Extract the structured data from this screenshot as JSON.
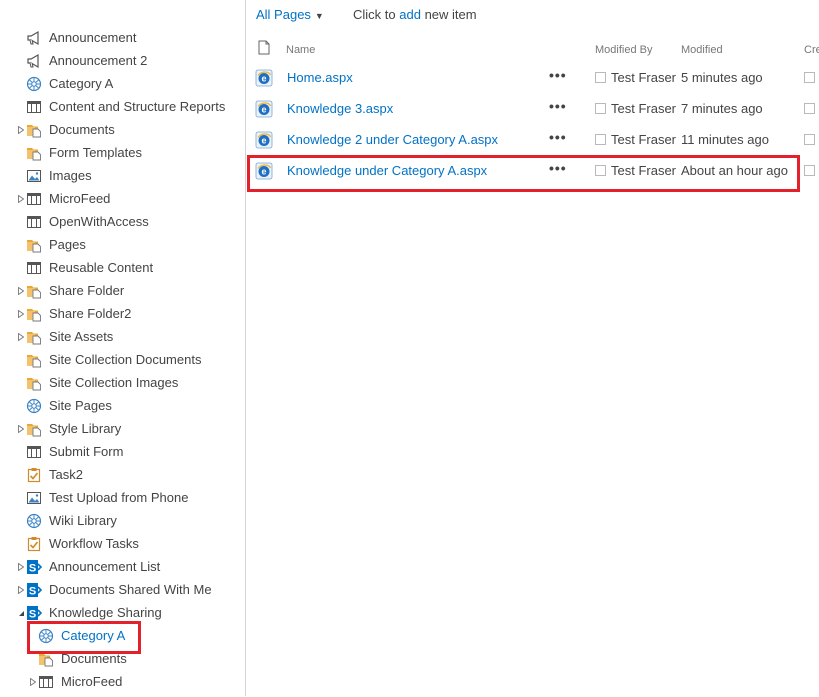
{
  "sidebar": {
    "items": [
      {
        "label": "Announcement",
        "icon": "announcement-icon",
        "expandable": false
      },
      {
        "label": "Announcement 2",
        "icon": "announcement-icon",
        "expandable": false
      },
      {
        "label": "Category A",
        "icon": "wiki-page-library-icon",
        "expandable": false
      },
      {
        "label": "Content and Structure Reports",
        "icon": "list-icon",
        "expandable": false
      },
      {
        "label": "Documents",
        "icon": "document-library-icon",
        "expandable": true
      },
      {
        "label": "Form Templates",
        "icon": "document-library-icon",
        "expandable": false
      },
      {
        "label": "Images",
        "icon": "picture-library-icon",
        "expandable": false
      },
      {
        "label": "MicroFeed",
        "icon": "list-icon",
        "expandable": true
      },
      {
        "label": "OpenWithAccess",
        "icon": "list-icon",
        "expandable": false
      },
      {
        "label": "Pages",
        "icon": "document-library-icon",
        "expandable": false
      },
      {
        "label": "Reusable Content",
        "icon": "list-icon",
        "expandable": false
      },
      {
        "label": "Share Folder",
        "icon": "document-library-icon",
        "expandable": true
      },
      {
        "label": "Share Folder2",
        "icon": "document-library-icon",
        "expandable": true
      },
      {
        "label": "Site Assets",
        "icon": "document-library-icon",
        "expandable": true
      },
      {
        "label": "Site Collection Documents",
        "icon": "document-library-icon",
        "expandable": false
      },
      {
        "label": "Site Collection Images",
        "icon": "document-library-icon",
        "expandable": false
      },
      {
        "label": "Site Pages",
        "icon": "wiki-page-library-icon",
        "expandable": false
      },
      {
        "label": "Style Library",
        "icon": "document-library-icon",
        "expandable": true
      },
      {
        "label": "Submit Form",
        "icon": "list-icon",
        "expandable": false
      },
      {
        "label": "Task2",
        "icon": "task-list-icon",
        "expandable": false
      },
      {
        "label": "Test Upload from Phone",
        "icon": "picture-library-icon",
        "expandable": false
      },
      {
        "label": "Wiki Library",
        "icon": "wiki-page-library-icon",
        "expandable": false
      },
      {
        "label": "Workflow Tasks",
        "icon": "task-list-icon",
        "expandable": false
      },
      {
        "label": "Announcement List",
        "icon": "sharepoint-site-icon",
        "expandable": true
      },
      {
        "label": "Documents Shared With Me",
        "icon": "sharepoint-site-icon",
        "expandable": true
      },
      {
        "label": "Knowledge Sharing",
        "icon": "sharepoint-site-icon",
        "expandable": true,
        "expanded": true
      },
      {
        "label": "Category A",
        "icon": "wiki-page-library-icon",
        "expandable": false,
        "child": true,
        "selected": true
      },
      {
        "label": "Documents",
        "icon": "document-library-icon",
        "expandable": false,
        "child": true
      },
      {
        "label": "MicroFeed",
        "icon": "list-icon",
        "expandable": true,
        "child": true
      }
    ]
  },
  "main": {
    "view_selector": "All Pages",
    "click_to_prefix": "Click to",
    "add_link": "add",
    "click_to_suffix": "new item",
    "columns": {
      "name": "Name",
      "modified_by": "Modified By",
      "modified": "Modified",
      "created_truncated": "Cre"
    },
    "rows": [
      {
        "name": "Home.aspx",
        "modified_by": "Test Fraser",
        "modified": "5 minutes ago",
        "ellipsis": "•••"
      },
      {
        "name": "Knowledge 3.aspx",
        "modified_by": "Test Fraser",
        "modified": "7 minutes ago",
        "ellipsis": "•••"
      },
      {
        "name": "Knowledge 2 under Category A.aspx",
        "modified_by": "Test Fraser",
        "modified": "11 minutes ago",
        "ellipsis": "•••"
      },
      {
        "name": "Knowledge under Category A.aspx",
        "modified_by": "Test Fraser",
        "modified": "About an hour ago",
        "ellipsis": "•••"
      }
    ]
  },
  "colors": {
    "link": "#0072c6",
    "text": "#444444",
    "highlight": "#e3212b",
    "folder": "#e8a838",
    "sharepoint": "#0072c6"
  }
}
